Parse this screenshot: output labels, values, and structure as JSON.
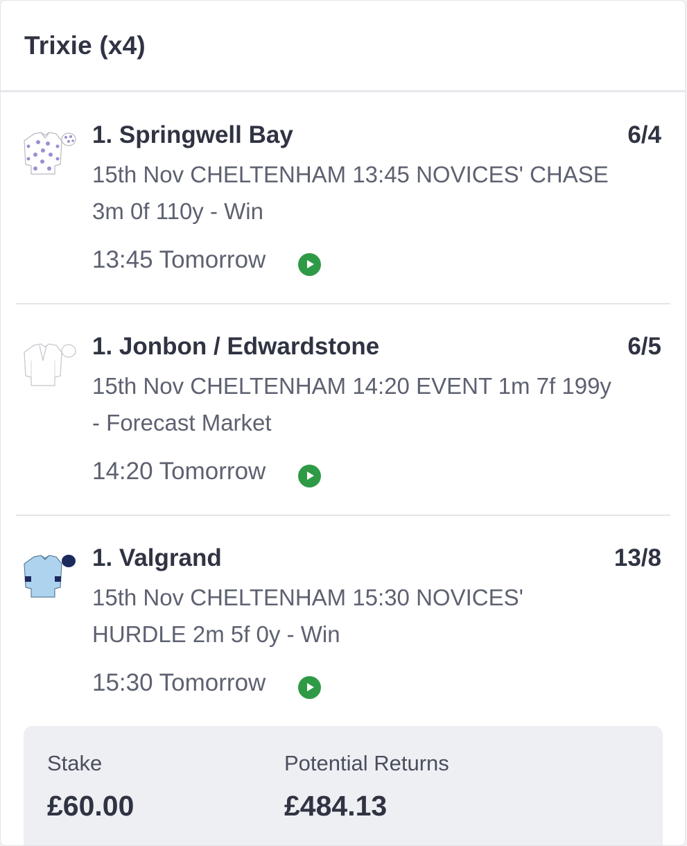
{
  "bet": {
    "title": "Trixie (x4)"
  },
  "selections": [
    {
      "name": "1. Springwell Bay",
      "odds": "6/4",
      "description": "15th Nov CHELTENHAM 13:45 NOVICES' CHASE 3m 0f 110y - Win",
      "time": "13:45 Tomorrow",
      "silk_icon": "silk-white-purple-stars-icon",
      "stream_icon": "play-icon"
    },
    {
      "name": "1. Jonbon / Edwardstone",
      "odds": "6/5",
      "description": "15th Nov CHELTENHAM 14:20 EVENT 1m 7f 199y - Forecast Market",
      "time": "14:20 Tomorrow",
      "silk_icon": "silk-generic-white-icon",
      "stream_icon": "play-icon"
    },
    {
      "name": "1. Valgrand",
      "odds": "13/8",
      "description": "15th Nov CHELTENHAM 15:30 NOVICES' HURDLE 2m 5f 0y - Win",
      "time": "15:30 Tomorrow",
      "silk_icon": "silk-light-blue-navy-armlets-icon",
      "stream_icon": "play-icon"
    }
  ],
  "summary": {
    "stake_label": "Stake",
    "stake_value": "£60.00",
    "returns_label": "Potential Returns",
    "returns_value": "£484.13"
  },
  "colors": {
    "play_icon": "#2f9a45",
    "silk_purple": "#9a8fd3",
    "silk_light_blue": "#aed3ee",
    "silk_navy": "#1b2a5c"
  }
}
